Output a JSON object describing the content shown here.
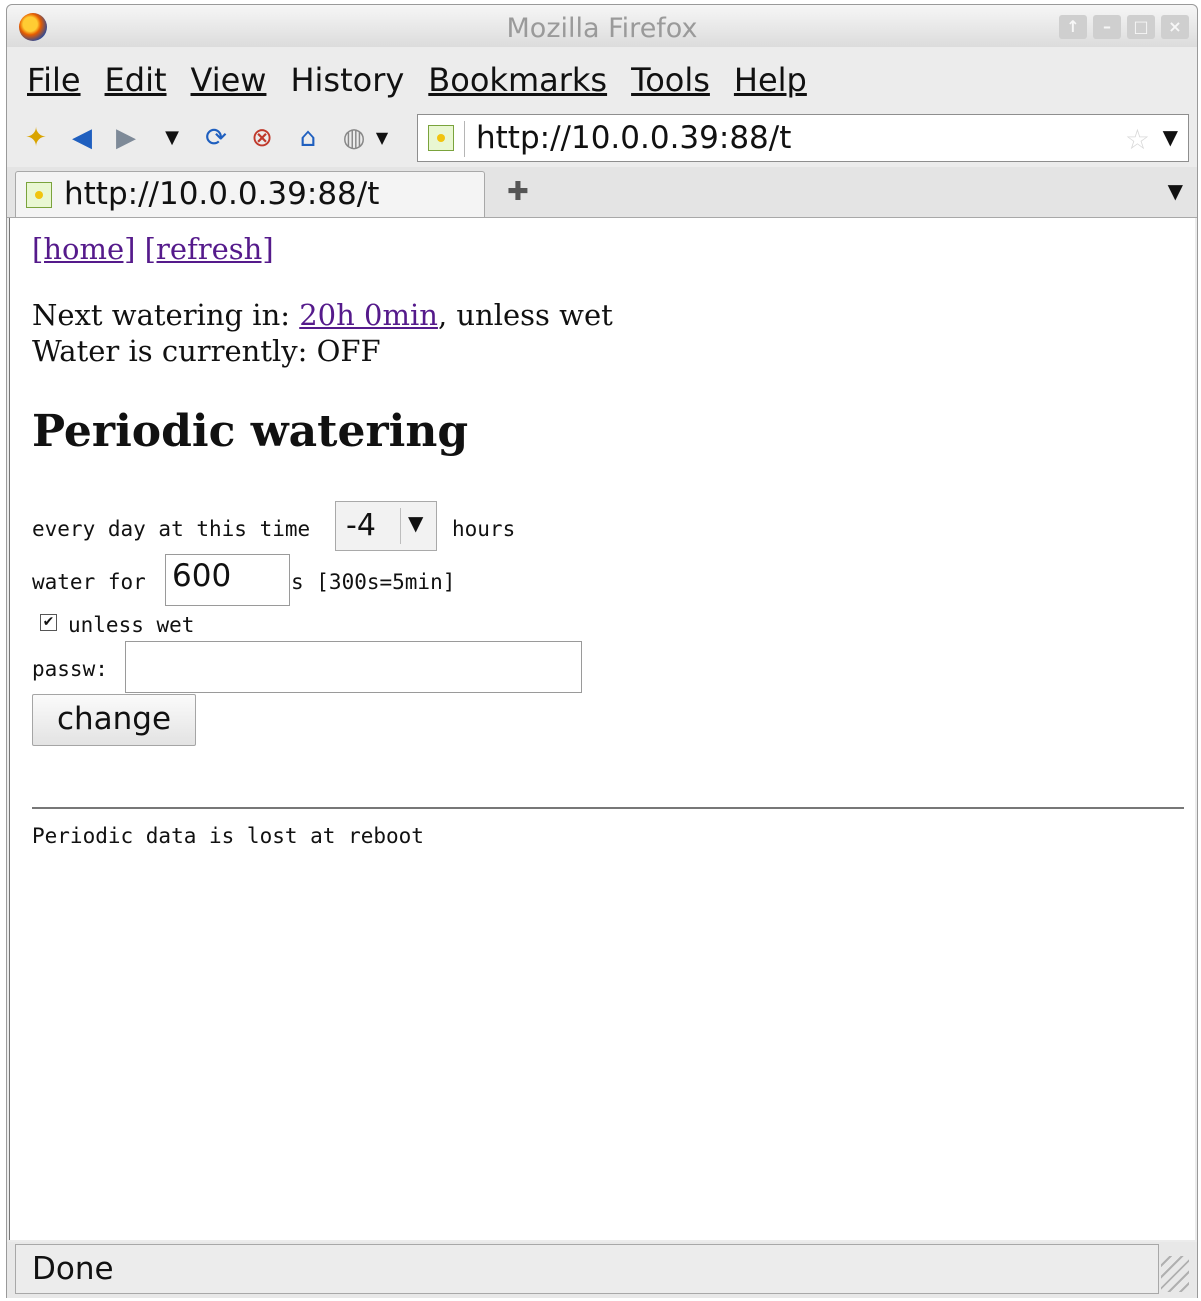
{
  "window": {
    "title": "Mozilla Firefox"
  },
  "menu": {
    "items": [
      "File",
      "Edit",
      "View",
      "History",
      "Bookmarks",
      "Tools",
      "Help"
    ]
  },
  "navbar": {
    "url": "http://10.0.0.39:88/t"
  },
  "tabs": {
    "items": [
      {
        "label": "http://10.0.0.39:88/t"
      }
    ]
  },
  "page": {
    "links": {
      "home": "[home]",
      "refresh": "[refresh]"
    },
    "next_watering_prefix": "Next watering in: ",
    "next_watering_link": "20h 0min",
    "next_watering_suffix": ", unless wet",
    "water_status": "Water is currently: OFF",
    "heading": "Periodic watering",
    "form": {
      "time_label": "every day at this time",
      "time_value": "-4",
      "time_unit": "hours",
      "duration_label": "water for",
      "duration_value": "600",
      "duration_unit": "s [300s=5min]",
      "unless_wet_label": "unless wet",
      "unless_wet_checked": true,
      "password_label": "passw:",
      "password_value": "",
      "submit_label": "change"
    },
    "footer_note": "Periodic data is lost at reboot"
  },
  "statusbar": {
    "text": "Done"
  }
}
